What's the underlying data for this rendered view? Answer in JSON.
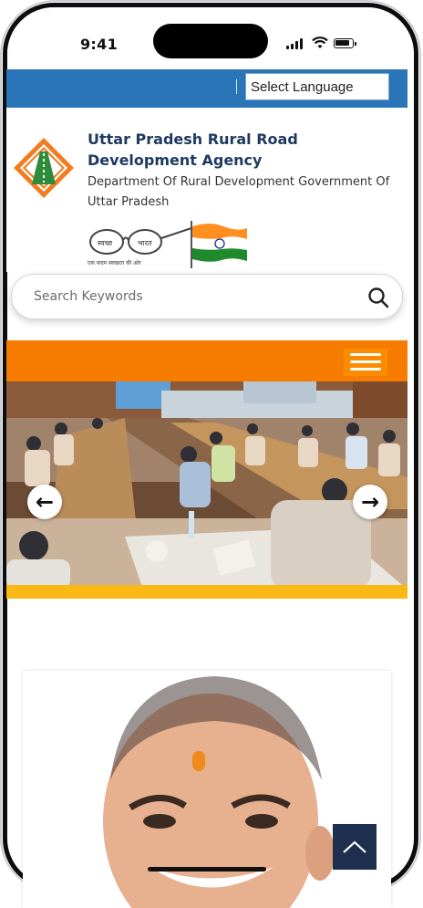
{
  "status_bar": {
    "time": "9:41"
  },
  "header": {
    "language_select": "Select Language",
    "org_name": "Uttar Pradesh Rural Road Development Agency",
    "department": "Department Of Rural Development Government Of Uttar Pradesh",
    "swachh_left": "स्वच्छ",
    "swachh_right": "भारत",
    "swachh_tagline": "एक कदम स्वच्छता की ओर"
  },
  "search": {
    "placeholder": "Search Keywords"
  },
  "slider": {
    "prev_glyph": "←",
    "next_glyph": "→"
  },
  "scroll_top_glyph": "^",
  "colors": {
    "topbar": "#2a74b8",
    "nav": "#f57c00",
    "accent_gold": "#f9b814",
    "title": "#1f3a62",
    "scroll_btn": "#1e2f4f"
  }
}
